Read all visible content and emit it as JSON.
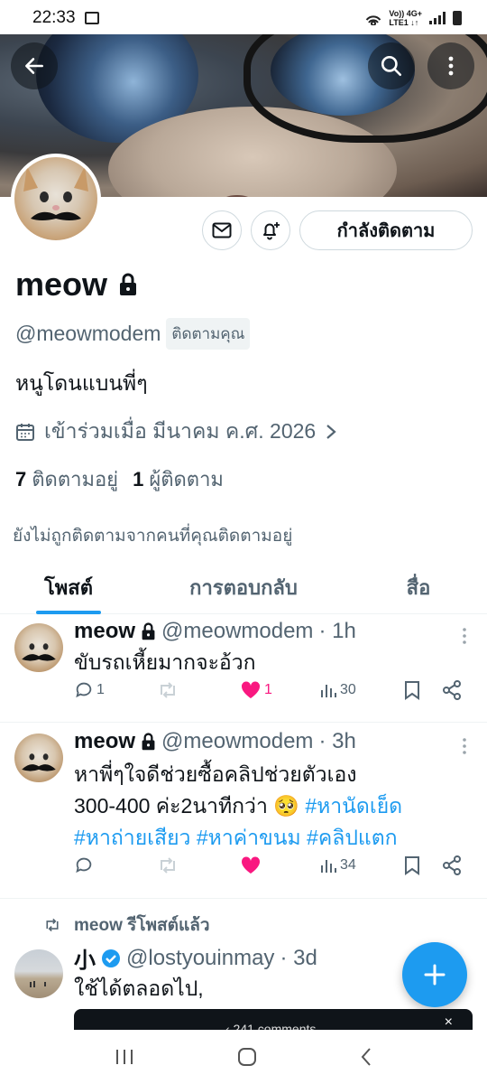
{
  "status_bar": {
    "time": "22:33",
    "network_top": "Vo)) 4G+",
    "network_bottom": "LTE1 ↓↑"
  },
  "profile": {
    "name": "meow",
    "handle": "@meowmodem",
    "follows_you": "ติดตามคุณ",
    "bio": "หนูโดนแบนพี่ๆ",
    "joined": "เข้าร่วมเมื่อ มีนาคม ค.ศ. 2026",
    "following_count": "7",
    "following_label": "ติดตามอยู่",
    "followers_count": "1",
    "followers_label": "ผู้ติดตาม",
    "not_followed_note": "ยังไม่ถูกติดตามจากคนที่คุณติดตามอยู่",
    "following_button": "กำลังติดตาม"
  },
  "tabs": [
    {
      "label": "โพสต์",
      "active": true
    },
    {
      "label": "การตอบกลับ",
      "active": false
    },
    {
      "label": "สื่อ",
      "active": false
    }
  ],
  "posts": [
    {
      "name": "meow",
      "handle": "@meowmodem",
      "time": "· 1h",
      "text": "ขับรถเหี้ยมากจะอ้วก",
      "replies": "1",
      "likes": "1",
      "views": "30"
    },
    {
      "name": "meow",
      "handle": "@meowmodem",
      "time": "· 3h",
      "text_line1": "หาพี่ๆใจดีช่วยซื้อคลิปช่วยตัวเอง",
      "text_line2_plain": "300-400 ค่ะ2นาทีกว่า 🥺 ",
      "tags": [
        "#หานัดเย็ด",
        "#หาถ่ายเสียว",
        "#หาค่าขนม",
        "#คลิปแตก"
      ],
      "views": "34"
    },
    {
      "repost_label": "meow รีโพสต์แล้ว",
      "name": "小",
      "handle": "@lostyouinmay",
      "time": "· 3d",
      "text": "ใช้ได้ตลอดไป,"
    }
  ],
  "snackbar": {
    "text": "‹ 241 comments",
    "close": "×"
  },
  "colors": {
    "accent": "#1d9bf0",
    "like": "#f91880",
    "secondary_text": "#536471"
  }
}
